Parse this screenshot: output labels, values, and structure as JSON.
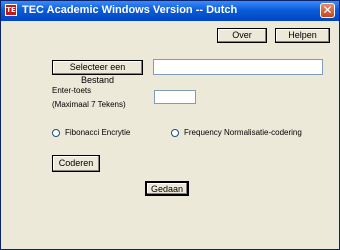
{
  "window": {
    "title": "TEC Academic Windows Version -- Dutch",
    "app_icon_text": "TE",
    "close_glyph": "✕"
  },
  "buttons": {
    "over": "Over",
    "helpen": "Helpen",
    "select_file": "Selecteer een Bestand",
    "coderen": "Coderen",
    "gedaan": "Gedaan"
  },
  "inputs": {
    "file_path": "",
    "enter_key": ""
  },
  "labels": {
    "enter_key": "Enter-toets",
    "max_chars": "(Maximaal 7 Tekens)"
  },
  "radios": [
    {
      "label": "Fibonacci Encrytie",
      "checked": false
    },
    {
      "label": "Frequency Normalisatie-codering",
      "checked": false
    }
  ],
  "colors": {
    "title_bar": "#0a5cd8",
    "window_bg": "#ece9d8",
    "close_button": "#c8461f"
  }
}
